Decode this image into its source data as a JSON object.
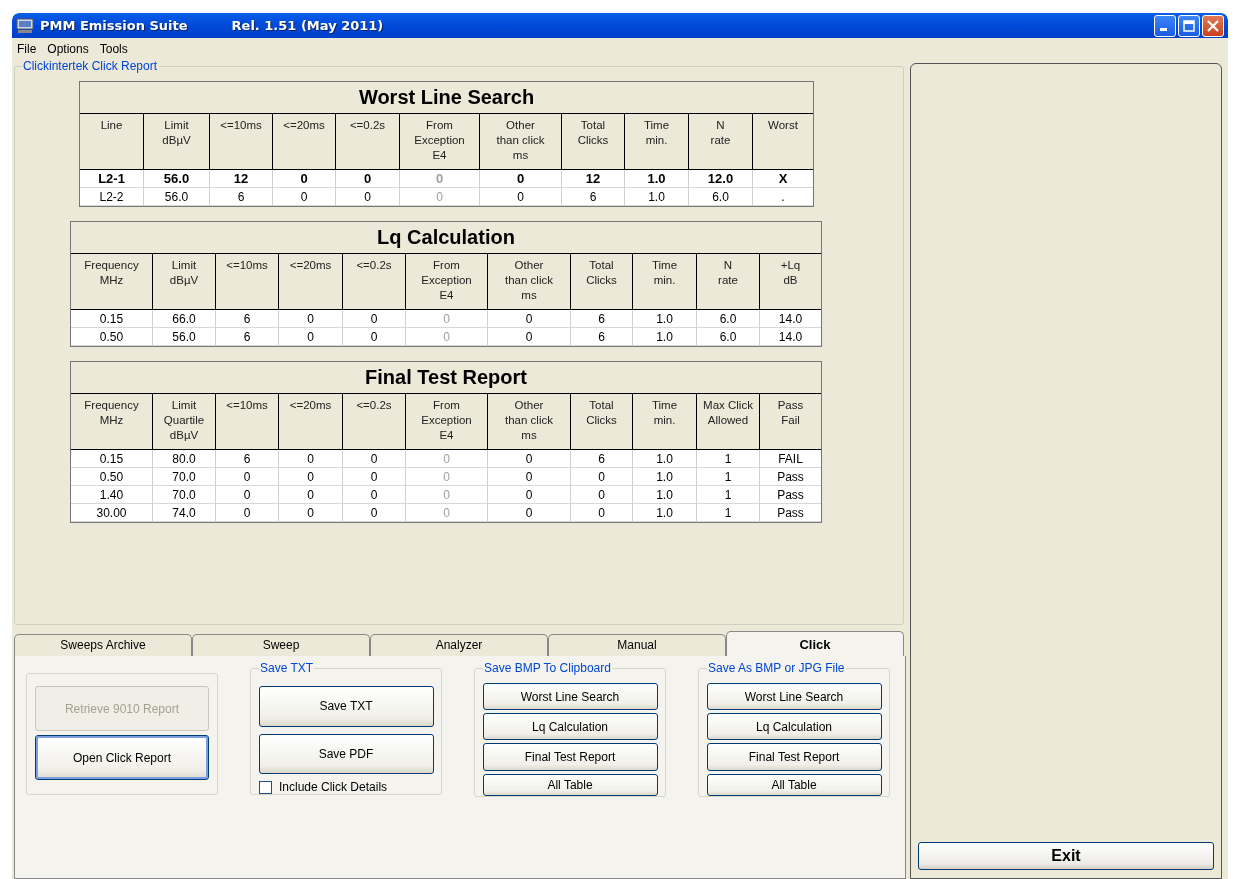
{
  "window": {
    "title": "PMM Emission Suite",
    "release": "Rel. 1.51 (May 2011)"
  },
  "menu": [
    "File",
    "Options",
    "Tools"
  ],
  "report_group": {
    "title": "Clickintertek Click Report"
  },
  "tables": [
    {
      "title": "Worst Line Search",
      "columns": [
        {
          "label": "Line",
          "disabled": false
        },
        {
          "label": "Limit\ndBµV",
          "disabled": false
        },
        {
          "label": "<=10ms",
          "disabled": false
        },
        {
          "label": "<=20ms",
          "disabled": false
        },
        {
          "label": "<=0.2s",
          "disabled": false
        },
        {
          "label": "From\nException\nE4",
          "disabled": true
        },
        {
          "label": "Other\nthan click\nms",
          "disabled": false
        },
        {
          "label": "Total\nClicks",
          "disabled": false
        },
        {
          "label": "Time\nmin.",
          "disabled": false
        },
        {
          "label": "N\nrate",
          "disabled": false
        },
        {
          "label": "Worst",
          "disabled": false
        }
      ],
      "rows": [
        {
          "bold": true,
          "cells": [
            "L2-1",
            "56.0",
            "12",
            "0",
            "0",
            "0",
            "0",
            "12",
            "1.0",
            "12.0",
            "X"
          ]
        },
        {
          "bold": false,
          "cells": [
            "L2-2",
            "56.0",
            "6",
            "0",
            "0",
            "0",
            "0",
            "6",
            "1.0",
            "6.0",
            "."
          ]
        }
      ]
    },
    {
      "title": "Lq Calculation",
      "columns": [
        {
          "label": "Frequency\nMHz",
          "disabled": false
        },
        {
          "label": "Limit\ndBµV",
          "disabled": false
        },
        {
          "label": "<=10ms",
          "disabled": false
        },
        {
          "label": "<=20ms",
          "disabled": false
        },
        {
          "label": "<=0.2s",
          "disabled": false
        },
        {
          "label": "From\nException\nE4",
          "disabled": true
        },
        {
          "label": "Other\nthan click\nms",
          "disabled": false
        },
        {
          "label": "Total\nClicks",
          "disabled": false
        },
        {
          "label": "Time\nmin.",
          "disabled": false
        },
        {
          "label": "N\nrate",
          "disabled": false
        },
        {
          "label": "+Lq\ndB",
          "disabled": false
        }
      ],
      "rows": [
        {
          "bold": false,
          "cells": [
            "0.15",
            "66.0",
            "6",
            "0",
            "0",
            "0",
            "0",
            "6",
            "1.0",
            "6.0",
            "14.0"
          ]
        },
        {
          "bold": false,
          "cells": [
            "0.50",
            "56.0",
            "6",
            "0",
            "0",
            "0",
            "0",
            "6",
            "1.0",
            "6.0",
            "14.0"
          ]
        }
      ]
    },
    {
      "title": "Final Test Report",
      "columns": [
        {
          "label": "Frequency\nMHz",
          "disabled": false
        },
        {
          "label": "Limit\nQuartile\ndBµV",
          "disabled": false
        },
        {
          "label": "<=10ms",
          "disabled": false
        },
        {
          "label": "<=20ms",
          "disabled": false
        },
        {
          "label": "<=0.2s",
          "disabled": false
        },
        {
          "label": "From\nException\nE4",
          "disabled": true
        },
        {
          "label": "Other\nthan click\nms",
          "disabled": false
        },
        {
          "label": "Total\nClicks",
          "disabled": false
        },
        {
          "label": "Time\nmin.",
          "disabled": false
        },
        {
          "label": "Max Click\nAllowed",
          "disabled": false
        },
        {
          "label": "Pass\nFail",
          "disabled": false
        }
      ],
      "rows": [
        {
          "bold": false,
          "cells": [
            "0.15",
            "80.0",
            "6",
            "0",
            "0",
            "0",
            "0",
            "6",
            "1.0",
            "1",
            "FAIL"
          ]
        },
        {
          "bold": false,
          "cells": [
            "0.50",
            "70.0",
            "0",
            "0",
            "0",
            "0",
            "0",
            "0",
            "1.0",
            "1",
            "Pass"
          ]
        },
        {
          "bold": false,
          "cells": [
            "1.40",
            "70.0",
            "0",
            "0",
            "0",
            "0",
            "0",
            "0",
            "1.0",
            "1",
            "Pass"
          ]
        },
        {
          "bold": false,
          "cells": [
            "30.00",
            "74.0",
            "0",
            "0",
            "0",
            "0",
            "0",
            "0",
            "1.0",
            "1",
            "Pass"
          ]
        }
      ]
    }
  ],
  "tabs": [
    {
      "label": "Sweeps Archive",
      "selected": false
    },
    {
      "label": "Sweep",
      "selected": false
    },
    {
      "label": "Analyzer",
      "selected": false
    },
    {
      "label": "Manual",
      "selected": false
    },
    {
      "label": "Click",
      "selected": true
    }
  ],
  "report_buttons": [
    {
      "label": "Retrieve 9010 Report",
      "disabled": true,
      "focused": false
    },
    {
      "label": "Open Click Report",
      "disabled": false,
      "focused": true
    }
  ],
  "save_txt": {
    "title": "Save TXT",
    "buttons": [
      "Save TXT",
      "Save PDF"
    ],
    "checkbox": {
      "label": "Include Click Details",
      "checked": false
    }
  },
  "save_bmp_clipboard": {
    "title": "Save BMP To Clipboard",
    "buttons": [
      "Worst Line Search",
      "Lq Calculation",
      "Final Test Report",
      "All Table"
    ]
  },
  "save_file": {
    "title": "Save As BMP or JPG File",
    "buttons": [
      "Worst Line Search",
      "Lq Calculation",
      "Final Test Report",
      "All Table"
    ]
  },
  "exit_button": "Exit"
}
